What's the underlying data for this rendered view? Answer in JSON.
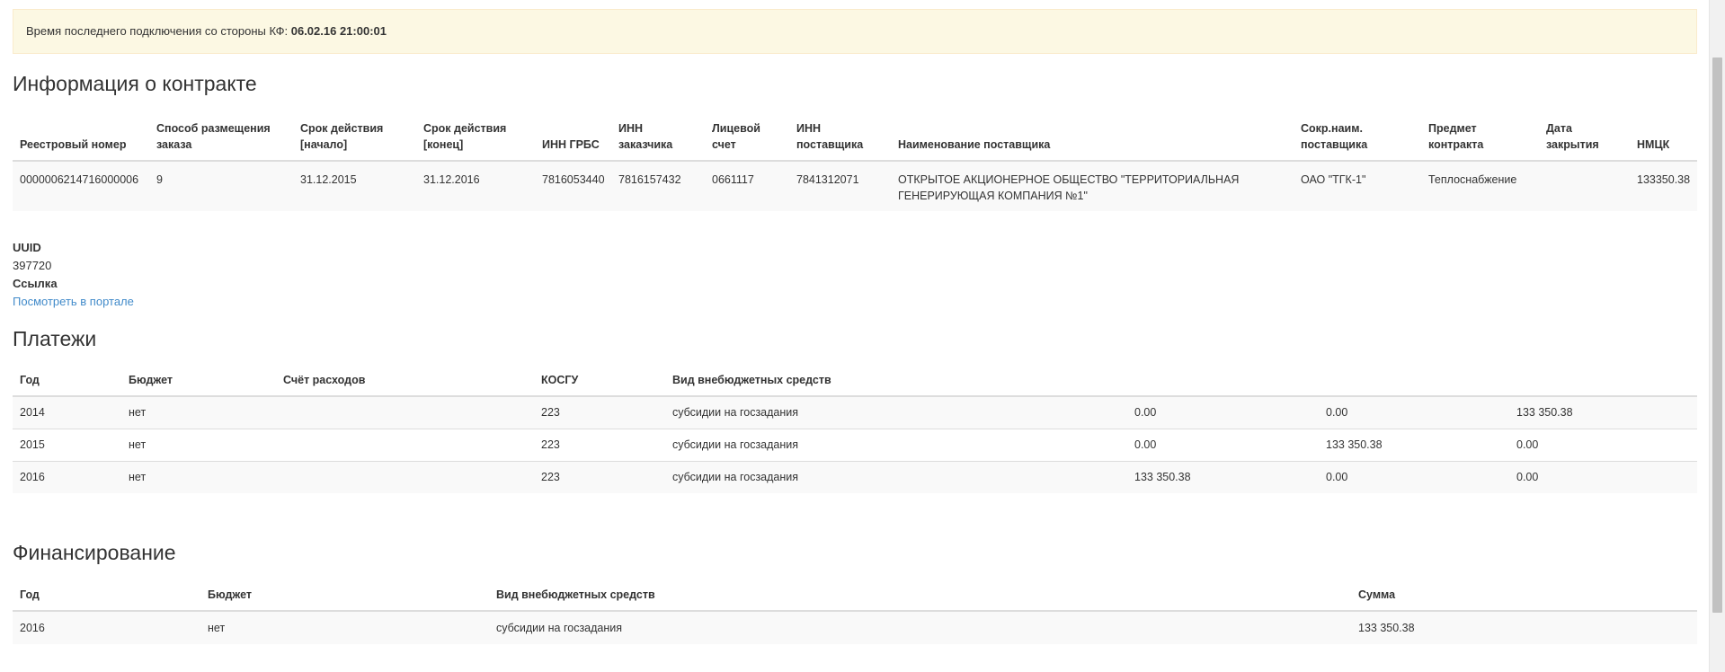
{
  "alert": {
    "label": "Время последнего подключения со стороны КФ:",
    "value": "06.02.16 21:00:01"
  },
  "contract": {
    "title": "Информация о контракте",
    "headers": [
      "Реестровый номер",
      "Способ размещения заказа",
      "Срок действия [начало]",
      "Срок действия [конец]",
      "ИНН ГРБС",
      "ИНН заказчика",
      "Лицевой счет",
      "ИНН поставщика",
      "Наименование поставщика",
      "Сокр.наим. поставщика",
      "Предмет контракта",
      "Дата закрытия",
      "НМЦК"
    ],
    "row": [
      "0000006214716000006",
      "9",
      "31.12.2015",
      "31.12.2016",
      "7816053440",
      "7816157432",
      "0661117",
      "7841312071",
      "ОТКРЫТОЕ АКЦИОНЕРНОЕ ОБЩЕСТВО \"ТЕРРИТОРИАЛЬНАЯ ГЕНЕРИРУЮЩАЯ КОМПАНИЯ №1\"",
      "ОАО \"ТГК-1\"",
      "Теплоснабжение",
      "",
      "133350.38"
    ]
  },
  "meta": {
    "uuid_label": "UUID",
    "uuid_value": "397720",
    "link_label": "Ссылка",
    "link_text": "Посмотреть в портале"
  },
  "payments": {
    "title": "Платежи",
    "headers": [
      "Год",
      "Бюджет",
      "Счёт расходов",
      "КОСГУ",
      "Вид внебюджетных средств",
      "",
      "",
      ""
    ],
    "rows": [
      [
        "2014",
        "нет",
        "",
        "223",
        "субсидии на госзадания",
        "0.00",
        "0.00",
        "133 350.38"
      ],
      [
        "2015",
        "нет",
        "",
        "223",
        "субсидии на госзадания",
        "0.00",
        "133 350.38",
        "0.00"
      ],
      [
        "2016",
        "нет",
        "",
        "223",
        "субсидии на госзадания",
        "133 350.38",
        "0.00",
        "0.00"
      ]
    ]
  },
  "finance": {
    "title": "Финансирование",
    "headers": [
      "Год",
      "Бюджет",
      "Вид внебюджетных средств",
      "Сумма"
    ],
    "rows": [
      [
        "2016",
        "нет",
        "субсидии на госзадания",
        "133 350.38"
      ]
    ]
  }
}
